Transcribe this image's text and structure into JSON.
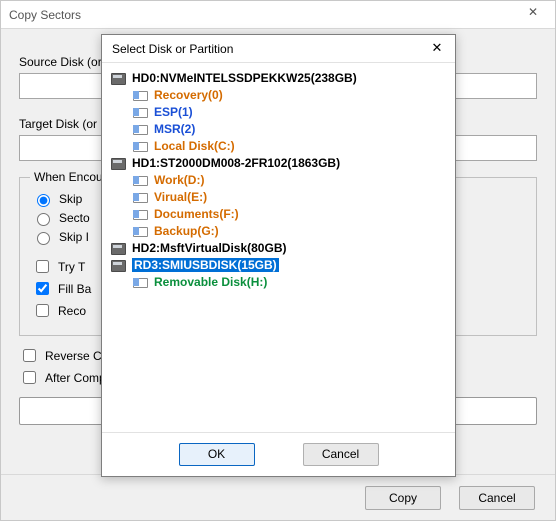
{
  "parent": {
    "title": "Copy Sectors",
    "close_glyph": "✕",
    "source_label": "Source Disk (or",
    "target_label": "Target Disk (or",
    "group_legend": "When Encount",
    "radios": {
      "skip": "Skip",
      "sect": "Secto",
      "skip2": "Skip I"
    },
    "checks": {
      "try": "Try T",
      "fill": "Fill Ba",
      "reco": "Reco"
    },
    "reverse": "Reverse Co",
    "after": "After Comp",
    "copy_btn": "Copy",
    "cancel_btn": "Cancel"
  },
  "modal": {
    "title": "Select Disk or Partition",
    "close_glyph": "✕",
    "ok": "OK",
    "cancel": "Cancel",
    "tree": [
      {
        "kind": "disk",
        "label": "HD0:NVMeINTELSSDPEKKW25(238GB)"
      },
      {
        "kind": "part",
        "color": "orange",
        "label": "Recovery(0)"
      },
      {
        "kind": "part",
        "color": "blue",
        "label": "ESP(1)"
      },
      {
        "kind": "part",
        "color": "blue",
        "label": "MSR(2)"
      },
      {
        "kind": "part",
        "color": "orange",
        "label": "Local Disk(C:)"
      },
      {
        "kind": "disk",
        "label": "HD1:ST2000DM008-2FR102(1863GB)"
      },
      {
        "kind": "part",
        "color": "orange",
        "label": "Work(D:)"
      },
      {
        "kind": "part",
        "color": "orange",
        "label": "Virual(E:)"
      },
      {
        "kind": "part",
        "color": "orange",
        "label": "Documents(F:)"
      },
      {
        "kind": "part",
        "color": "orange",
        "label": "Backup(G:)"
      },
      {
        "kind": "disk",
        "label": "HD2:MsftVirtualDisk(80GB)"
      },
      {
        "kind": "disk",
        "selected": true,
        "label": "RD3:SMIUSBDISK(15GB)"
      },
      {
        "kind": "part",
        "color": "green",
        "label": "Removable Disk(H:)"
      }
    ]
  }
}
